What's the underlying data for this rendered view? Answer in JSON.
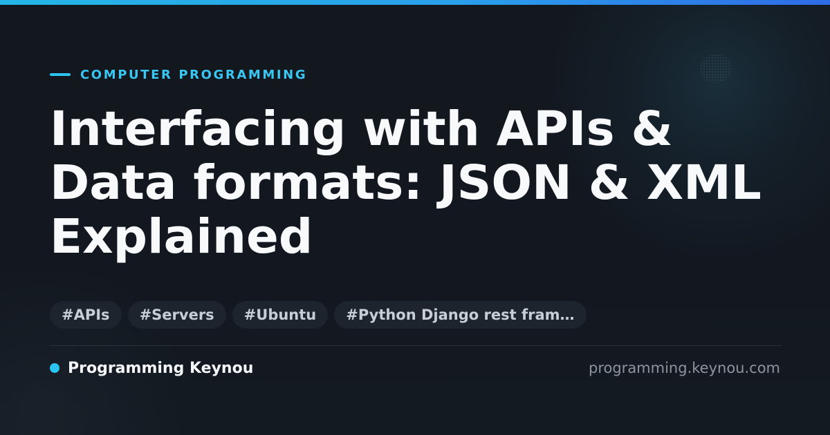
{
  "category": {
    "label": "COMPUTER PROGRAMMING"
  },
  "title": {
    "lines": [
      "Interfacing with APIs &",
      "Data formats: JSON & XML",
      "Explained"
    ]
  },
  "tags": [
    "#APIs",
    "#Servers",
    "#Ubuntu",
    "#Python Django rest fram…"
  ],
  "footer": {
    "author": "Programming Keynou",
    "site": "programming.keynou.com"
  },
  "colors": {
    "accent": "#2cc4f0",
    "background": "#13171e",
    "title_text": "#f7f9fb",
    "tag_background": "#1d242d"
  },
  "icons": {
    "category_marker": "dash-icon",
    "author_marker": "dot-icon"
  }
}
